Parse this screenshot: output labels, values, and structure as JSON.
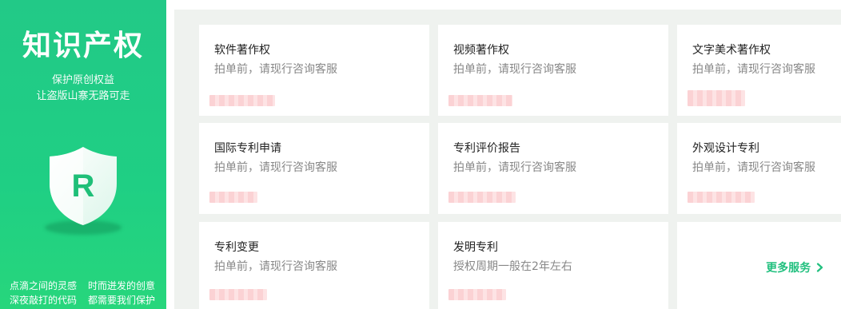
{
  "banner": {
    "title": "知识产权",
    "subtitle_line1": "保护原创权益",
    "subtitle_line2": "让盗版山寨无路可走",
    "shield_letter": "R",
    "slogans": [
      "点滴之间的灵感",
      "时而迸发的创意",
      "深夜敲打的代码",
      "都需要我们保护"
    ]
  },
  "services": [
    {
      "name": "软件著作权",
      "desc": "拍单前，请现行咨询客服"
    },
    {
      "name": "视频著作权",
      "desc": "拍单前，请现行咨询客服"
    },
    {
      "name": "文字美术著作权",
      "desc": "拍单前，请现行咨询客服"
    },
    {
      "name": "国际专利申请",
      "desc": "拍单前，请现行咨询客服"
    },
    {
      "name": "专利评价报告",
      "desc": "拍单前，请现行咨询客服"
    },
    {
      "name": "外观设计专利",
      "desc": "拍单前，请现行咨询客服"
    },
    {
      "name": "专利变更",
      "desc": "拍单前，请现行咨询客服"
    },
    {
      "name": "发明专利",
      "desc": "授权周期一般在2年左右"
    }
  ],
  "more": {
    "label": "更多服务",
    "icon": "chevron-right-icon"
  },
  "colors": {
    "brand_green": "#22c987",
    "link_green": "#22c07f",
    "panel_bg": "#eff2ef",
    "price_blur": "#fbd2d4"
  }
}
